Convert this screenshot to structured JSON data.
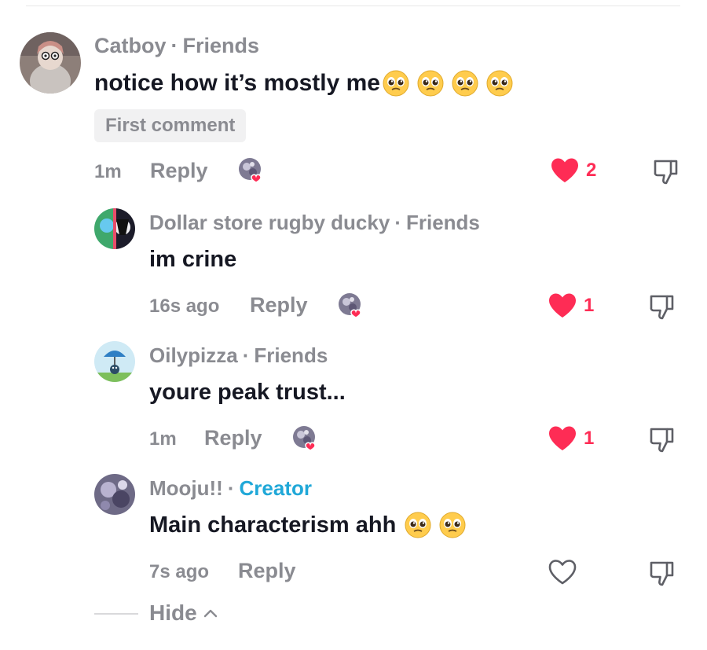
{
  "colors": {
    "like": "#fe2c55",
    "muted": "#8a8b91",
    "creator": "#20a8d8",
    "text": "#161823"
  },
  "comments": [
    {
      "username": "Catboy",
      "relation": "Friends",
      "text": "notice how it’s mostly me",
      "emoji_count": 4,
      "emoji_icon": "pleading-face-emoji",
      "badge": "First comment",
      "time": "1m",
      "reply_label": "Reply",
      "liked_by_creator": true,
      "likes": "2",
      "liked": true
    },
    {
      "username": "Dollar store rugby ducky",
      "relation": "Friends",
      "text": "im crine",
      "time": "16s ago",
      "reply_label": "Reply",
      "liked_by_creator": true,
      "likes": "1",
      "liked": true
    },
    {
      "username": "Oilypizza",
      "relation": "Friends",
      "text": "youre peak trust...",
      "time": "1m",
      "reply_label": "Reply",
      "liked_by_creator": true,
      "likes": "1",
      "liked": true
    },
    {
      "username": "Mooju!!",
      "relation": "Creator",
      "text": "Main characterism ahh",
      "emoji_count": 2,
      "emoji_icon": "pleading-face-emoji",
      "time": "7s ago",
      "reply_label": "Reply",
      "liked_by_creator": false,
      "likes": "",
      "liked": false
    }
  ],
  "hide_label": "Hide",
  "separator": "·"
}
